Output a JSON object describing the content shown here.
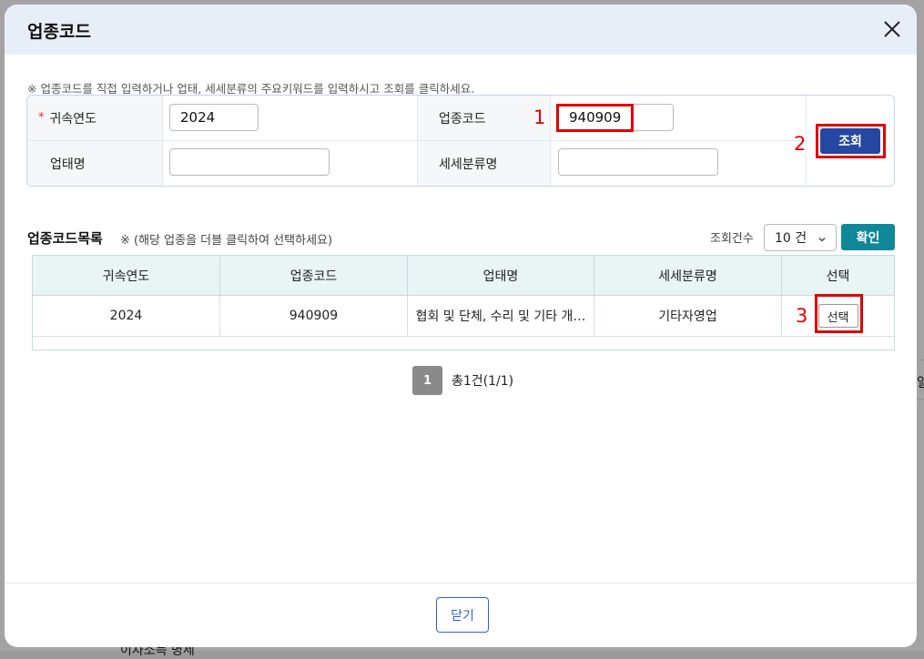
{
  "modal": {
    "title": "업종코드",
    "notice": "※ 업종코드를 직접 입력하거나 업태, 세세분류의 주요키워드를 입력하시고 조회를 클릭하세요."
  },
  "search": {
    "year_label": "귀속연도",
    "year_value": "2024",
    "code_label": "업종코드",
    "code_value": "940909",
    "business_label": "업태명",
    "business_value": "",
    "subclass_label": "세세분류명",
    "subclass_value": "",
    "search_button": "조회",
    "required_mark": "*"
  },
  "annotations": {
    "step1": "1",
    "step2": "2",
    "step3": "3"
  },
  "list": {
    "title": "업종코드목록",
    "hint": "※ (해당 업종을 더블 클릭하여 선택하세요)",
    "count_label": "조회건수",
    "count_value": "10 건",
    "confirm_button": "확인",
    "columns": [
      "귀속연도",
      "업종코드",
      "업태명",
      "세세분류명",
      "선택"
    ],
    "rows": [
      {
        "year": "2024",
        "code": "940909",
        "business": "협회 및 단체, 수리 및 기타 개…",
        "subclass": "기타자영업",
        "select": "선택"
      }
    ]
  },
  "pagination": {
    "current": "1",
    "total": "총1건(1/1)"
  },
  "footer": {
    "close_button": "닫기"
  },
  "background": {
    "bottom_text": "이자소득 명세",
    "right_text": "일"
  },
  "colors": {
    "header_bg": "#e8eef8",
    "search_button": "#2447a1",
    "confirm_button": "#10889a",
    "annotation_red": "#e00000",
    "table_header": "#e9f4f4"
  }
}
